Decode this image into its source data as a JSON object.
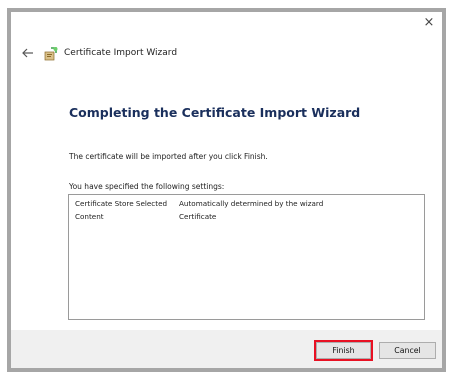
{
  "window": {
    "title": "Certificate Import Wizard",
    "close_glyph": "×",
    "back_icon": "back-arrow-icon",
    "app_icon": "certificate-wizard-icon"
  },
  "content": {
    "heading": "Completing the Certificate Import Wizard",
    "info": "The certificate will be imported after you click Finish.",
    "settings_label": "You have specified the following settings:",
    "settings": [
      {
        "key": "Certificate Store Selected",
        "value": "Automatically determined by the wizard"
      },
      {
        "key": "Content",
        "value": "Certificate"
      }
    ]
  },
  "footer": {
    "finish_label": "Finish",
    "cancel_label": "Cancel"
  },
  "colors": {
    "heading": "#1a2f5c",
    "highlight": "#e81123",
    "frame_border": "#a6a6a6"
  }
}
